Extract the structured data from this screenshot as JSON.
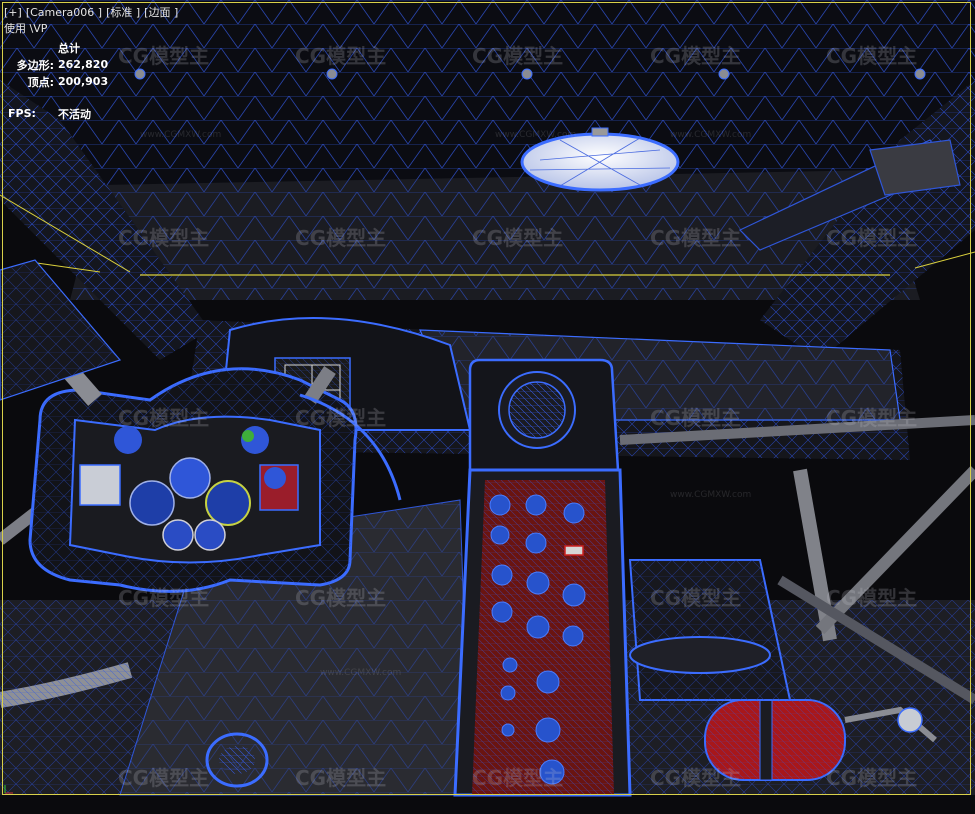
{
  "viewport": {
    "menu": [
      "[+]",
      "[Camera006 ]",
      "[标准 ]",
      "[边面 ]"
    ],
    "sub_label": "使用 \\VP"
  },
  "stats": {
    "header": "总计",
    "rows": [
      {
        "key": "多边形:",
        "value": "262,820"
      },
      {
        "key": "顶点:",
        "value": "200,903"
      }
    ],
    "fps_key": "FPS:",
    "fps_value": "不活动"
  },
  "watermark": {
    "text": "CG模型主",
    "small_text": "www.CGMXW.com"
  },
  "colors": {
    "wire": "#2f56d8",
    "wire_bright": "#3b6cff",
    "border": "#d8d04a",
    "panel_red": "#7a1512"
  }
}
